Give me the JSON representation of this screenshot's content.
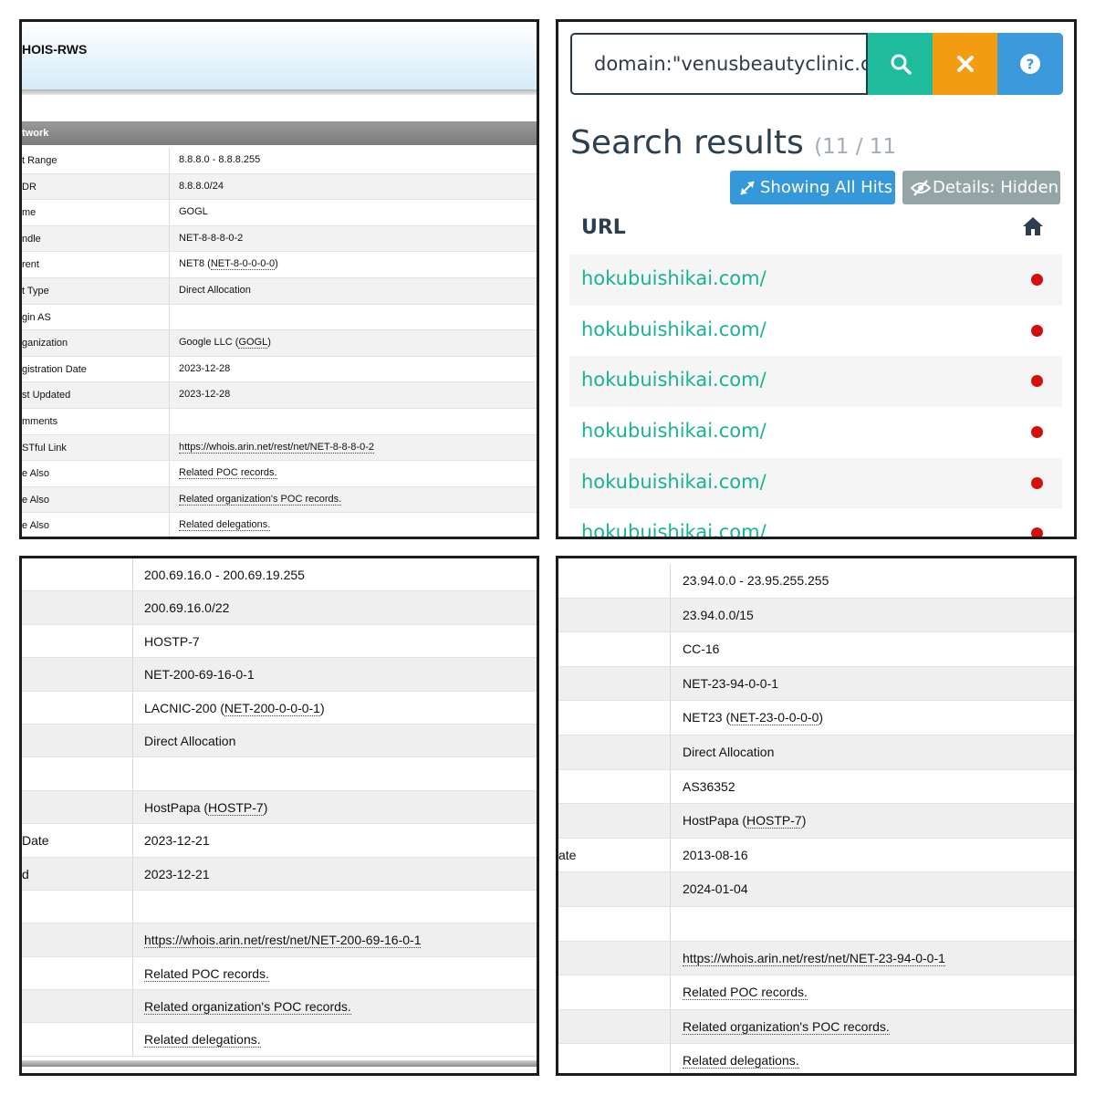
{
  "whois_top_left": {
    "title": "HOIS-RWS",
    "section": "twork",
    "rows": [
      {
        "label": "t Range",
        "value": "8.8.8.0 - 8.8.8.255"
      },
      {
        "label": "DR",
        "value": "8.8.8.0/24"
      },
      {
        "label": "me",
        "value": "GOGL"
      },
      {
        "label": "ndle",
        "value": "NET-8-8-8-0-2"
      },
      {
        "label": "rent",
        "value_prefix": "NET8 (",
        "value_link": "NET-8-0-0-0-0",
        "value_suffix": ")"
      },
      {
        "label": "t Type",
        "value": "Direct Allocation"
      },
      {
        "label": "gin AS",
        "value": ""
      },
      {
        "label": "ganization",
        "value_prefix": "Google LLC (",
        "value_link": "GOGL",
        "value_suffix": ")"
      },
      {
        "label": "gistration Date",
        "value": "2023-12-28"
      },
      {
        "label": "st Updated",
        "value": "2023-12-28"
      },
      {
        "label": "mments",
        "value": ""
      },
      {
        "label": "STful Link",
        "value_link": "https://whois.arin.net/rest/net/NET-8-8-8-0-2"
      },
      {
        "label": "e Also",
        "value_link": "Related POC records."
      },
      {
        "label": "e Also",
        "value_link": "Related organization's POC records."
      },
      {
        "label": "e Also",
        "value_link": "Related delegations."
      }
    ]
  },
  "search_panel": {
    "query": "domain:\"venusbeautyclinic.c",
    "search_icon": "search-icon",
    "clear_icon": "close-icon",
    "help_icon": "question-icon",
    "title": "Search results",
    "count": "(11 / 11",
    "showing_all_hits": "Showing All Hits",
    "details_hidden": "Details: Hidden",
    "column_url": "URL",
    "home_icon": "home-icon",
    "results": [
      {
        "url": "hokubuishikai.com/",
        "status_color": "#d40d0d"
      },
      {
        "url": "hokubuishikai.com/",
        "status_color": "#d40d0d"
      },
      {
        "url": "hokubuishikai.com/",
        "status_color": "#d40d0d"
      },
      {
        "url": "hokubuishikai.com/",
        "status_color": "#d40d0d"
      },
      {
        "url": "hokubuishikai.com/",
        "status_color": "#d40d0d"
      },
      {
        "url": "hokubuishikai.com/",
        "status_color": "#d40d0d"
      }
    ],
    "colors": {
      "search": "#1ebc9d",
      "clear": "#f39c12",
      "help": "#3b99dc",
      "link": "#18b394"
    }
  },
  "whois_bottom_left": {
    "rows": [
      {
        "label": "",
        "value": "200.69.16.0 - 200.69.19.255"
      },
      {
        "label": "",
        "value": "200.69.16.0/22"
      },
      {
        "label": "",
        "value": "HOSTP-7"
      },
      {
        "label": "",
        "value": "NET-200-69-16-0-1"
      },
      {
        "label": "",
        "value_prefix": "LACNIC-200 (",
        "value_link": "NET-200-0-0-0-1",
        "value_suffix": ")"
      },
      {
        "label": "",
        "value": "Direct Allocation"
      },
      {
        "label": "",
        "value": ""
      },
      {
        "label": "",
        "value_prefix": "HostPapa (",
        "value_link": "HOSTP-7",
        "value_suffix": ")"
      },
      {
        "label": "Date",
        "value": "2023-12-21"
      },
      {
        "label": "d",
        "value": "2023-12-21"
      },
      {
        "label": "",
        "value": ""
      },
      {
        "label": "",
        "value_link": "https://whois.arin.net/rest/net/NET-200-69-16-0-1"
      },
      {
        "label": "",
        "value_link": "Related POC records."
      },
      {
        "label": "",
        "value_link": "Related organization's POC records."
      },
      {
        "label": "",
        "value_link": "Related delegations."
      }
    ]
  },
  "whois_bottom_right": {
    "rows": [
      {
        "label": "",
        "value": "23.94.0.0 - 23.95.255.255"
      },
      {
        "label": "",
        "value": "23.94.0.0/15"
      },
      {
        "label": "",
        "value": "CC-16"
      },
      {
        "label": "",
        "value": "NET-23-94-0-0-1"
      },
      {
        "label": "",
        "value_prefix": "NET23 (",
        "value_link": "NET-23-0-0-0-0",
        "value_suffix": ")"
      },
      {
        "label": "",
        "value": "Direct Allocation"
      },
      {
        "label": "",
        "value": "AS36352"
      },
      {
        "label": "",
        "value_prefix": "HostPapa (",
        "value_link": "HOSTP-7",
        "value_suffix": ")"
      },
      {
        "label": "ate",
        "value": "2013-08-16"
      },
      {
        "label": "",
        "value": "2024-01-04"
      },
      {
        "label": "",
        "value": ""
      },
      {
        "label": "",
        "value_link": "https://whois.arin.net/rest/net/NET-23-94-0-0-1"
      },
      {
        "label": "",
        "value_link": "Related POC records."
      },
      {
        "label": "",
        "value_link": "Related organization's POC records."
      },
      {
        "label": "",
        "value_link": "Related delegations."
      }
    ]
  }
}
